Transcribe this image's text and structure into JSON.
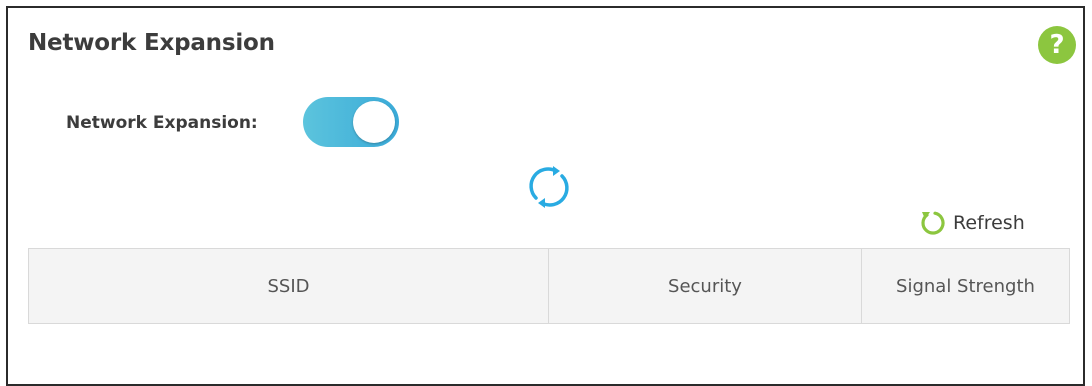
{
  "page": {
    "title": "Network Expansion"
  },
  "help": {
    "icon": "question-mark-icon",
    "glyph": "?",
    "color": "#8cc63f"
  },
  "network_expansion": {
    "label": "Network Expansion:",
    "enabled": true,
    "toggle_color": "#3aaad8"
  },
  "loading": {
    "icon": "loading-spinner-icon",
    "color": "#29abe2"
  },
  "refresh": {
    "label": "Refresh",
    "icon": "refresh-icon",
    "color": "#8cc63f"
  },
  "table": {
    "columns": [
      "SSID",
      "Security",
      "Signal Strength"
    ],
    "rows": []
  }
}
